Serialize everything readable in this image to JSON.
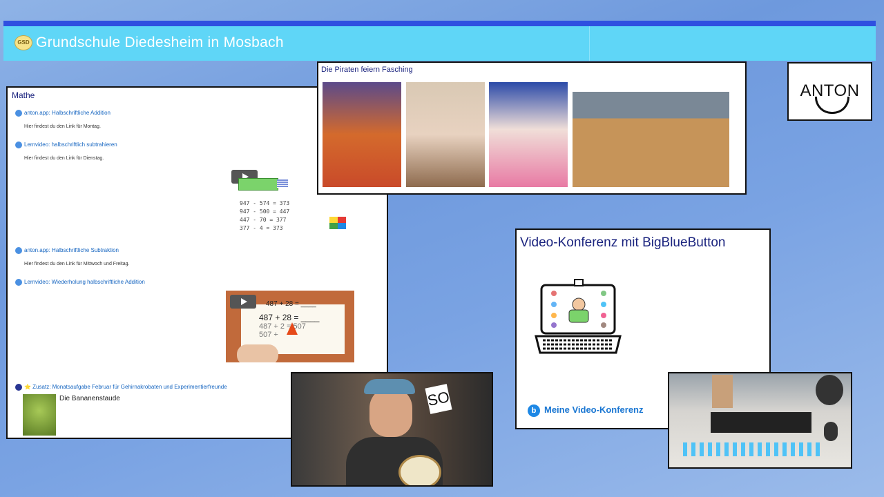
{
  "header": {
    "logo_text": "GSD",
    "school_name": "Grundschule Diedesheim in Mosbach"
  },
  "mathe": {
    "title": "Mathe",
    "items": [
      {
        "link": "anton.app: Halbschriftliche Addition",
        "desc": "Hier findest du den Link für Montag."
      },
      {
        "link": "Lernvideo: halbschriftlich subtrahieren",
        "desc": "Hier findest du den Link für Dienstag."
      },
      {
        "link": "anton.app: Halbschriftliche Subtraktion",
        "desc": "Hier findest du den Link für Mittwoch und Freitag."
      },
      {
        "link": "Lernvideo: Wiederholung halbschriftliche Addition",
        "desc": ""
      },
      {
        "link": "⭐ Zusatz: Monatsaufgabe Februar für Gehirnakrobaten und Experimentierfreunde",
        "desc": ""
      }
    ],
    "thumb_equations": [
      "947 - 574 = 373",
      "947 - 500 = 447",
      "447 - 70 = 377",
      "377 - 4 = 373"
    ],
    "video_equations": [
      "487 + 28 = ____",
      "487 + 28 = ____",
      "487 + 2 = 507",
      "507 +"
    ],
    "banana_label": "Die Bananenstaude"
  },
  "piraten": {
    "title": "Die Piraten feiern Fasching"
  },
  "anton": {
    "logo_text": "ANTON"
  },
  "videoconf": {
    "title": "Video-Konferenz mit BigBlueButton",
    "link": "Meine Video-Konferenz",
    "icon_letter": "b"
  },
  "teacher_video": {
    "card_text": "SO"
  }
}
